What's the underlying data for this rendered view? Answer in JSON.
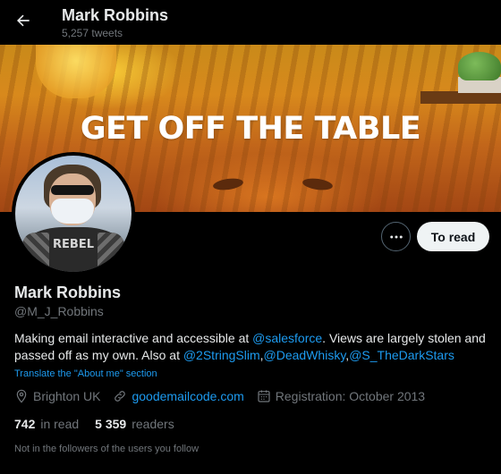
{
  "header": {
    "name": "Mark Robbins",
    "tweet_count": "5,257 tweets"
  },
  "banner": {
    "text": "GET OFF THE TABLE"
  },
  "avatar": {
    "shirt_text": "REBEL"
  },
  "actions": {
    "follow_label": "To read",
    "more_icon": "more-icon"
  },
  "profile": {
    "name": "Mark Robbins",
    "handle": "@M_J_Robbins",
    "bio_prefix": "Making email interactive and accessible at ",
    "bio_mention_1": "@salesforce",
    "bio_middle": ". Views are largely stolen and passed off as my own. Also at ",
    "bio_mention_2": "@2StringSlim",
    "bio_sep_1": ",",
    "bio_mention_3": "@DeadWhisky",
    "bio_sep_2": ",",
    "bio_mention_4": "@S_TheDarkStars",
    "translate_label": "Translate the \"About me\" section"
  },
  "meta": {
    "location": "Brighton UK",
    "website": "goodemailcode.com",
    "joined": "Registration: October 2013"
  },
  "stats": {
    "following_count": "742",
    "following_label": "in read",
    "followers_count": "5 359",
    "followers_label": "readers"
  },
  "note": "Not in the followers of the users you follow",
  "colors": {
    "background": "#000000",
    "accent": "#1d9bf0",
    "muted": "#71767b",
    "text": "#e7e9ea"
  }
}
